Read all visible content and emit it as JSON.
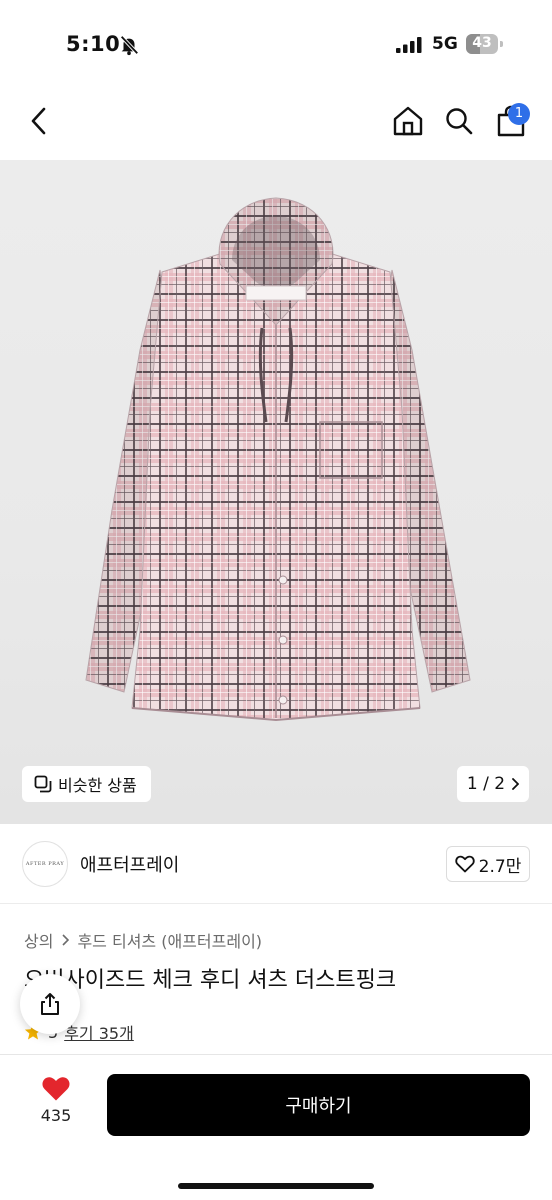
{
  "status": {
    "time": "5:10",
    "network": "5G",
    "battery": "43",
    "battery_level": 0.43
  },
  "nav": {
    "cart_count": "1"
  },
  "hero": {
    "similar_label": "비슷한 상품",
    "pager": "1 / 2"
  },
  "brand": {
    "name": "애프터프레이",
    "logo_text": "AFTER PRAY",
    "likes": "2.7만"
  },
  "product": {
    "breadcrumb": [
      "상의",
      "후드 티셔츠 (애프터프레이)"
    ],
    "title": "오버사이즈드 체크 후디 셔츠 더스트핑크",
    "rating": "5",
    "review_link": "후기 35개"
  },
  "bottom": {
    "heart_count": "435",
    "buy_label": "구매하기"
  },
  "colors": {
    "accent_blue": "#2f6fe8",
    "heart_red": "#e3262d",
    "star": "#f5b400",
    "shirt_pink": "#e9c7cc",
    "check_dark": "#4d3f45"
  }
}
